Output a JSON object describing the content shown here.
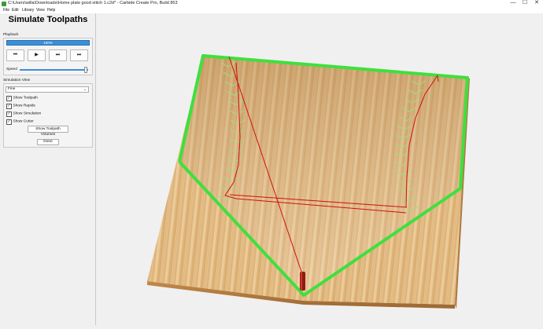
{
  "window": {
    "title": "C:\\Users\\willa\\Downloads\\Home plate good stitch 1.c2d* - Carbide Create Pro, Build 853",
    "minimize": "—",
    "maximize": "☐",
    "close": "✕"
  },
  "menu": [
    "File",
    "Edit",
    "Library",
    "View",
    "Help"
  ],
  "panel": {
    "title": "Simulate Toolpaths",
    "playback_label": "Playback",
    "progress_text": "100%",
    "progress_value": 100,
    "buttons": [
      "⏮",
      "▶",
      "⏭",
      "⏭"
    ],
    "speed_label": "Speed",
    "speed_value": 0.97,
    "sim_view_label": "Simulation View",
    "sim_view_value": "Fine",
    "checks": [
      {
        "label": "Show Toolpath",
        "checked": true
      },
      {
        "label": "Show Rapids",
        "checked": true
      },
      {
        "label": "Show Simulation",
        "checked": true
      },
      {
        "label": "Show Cutter",
        "checked": true
      }
    ],
    "volumes_button": "Show Toolpath Volumes",
    "done_button": "Done"
  },
  "colors": {
    "outline": "#33dd33",
    "rapid": "#d01010",
    "stitch": "#a8e888",
    "wood_light": "#e8c48e",
    "wood_dark": "#c8955a",
    "progress": "#3b8fd9"
  }
}
